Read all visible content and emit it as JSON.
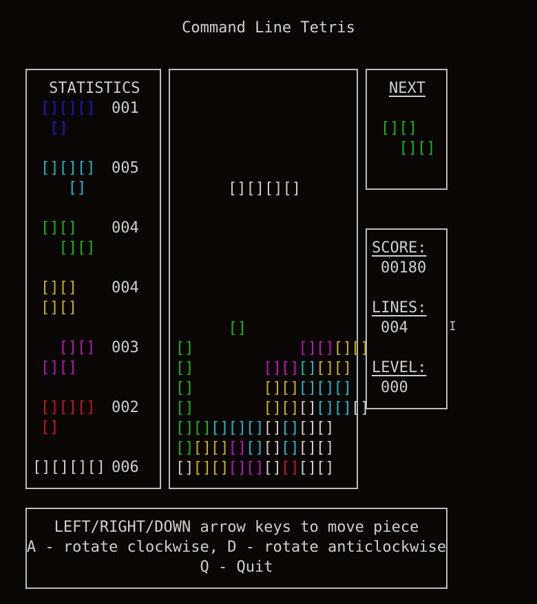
{
  "title": "Command Line Tetris",
  "colors": {
    "I": "#1a1ac8",
    "T": "#20b8c8",
    "Z": "#18b818",
    "O": "#c8b418",
    "S": "#b818b8",
    "L": "#c81818",
    "J": "#cfcfcf"
  },
  "block": "[]",
  "statistics": {
    "heading": "STATISTICS",
    "pieces": [
      {
        "kind": "I",
        "rows": [
          "[][][]",
          " []"
        ],
        "count": "001"
      },
      {
        "kind": "T",
        "rows": [
          "[][][]",
          "   []"
        ],
        "count": "005"
      },
      {
        "kind": "Z",
        "rows": [
          "[][]",
          "  [][]"
        ],
        "count": "004"
      },
      {
        "kind": "O",
        "rows": [
          "[][]",
          "[][]"
        ],
        "count": "004"
      },
      {
        "kind": "S",
        "rows": [
          "  [][]",
          "[][]"
        ],
        "count": "003"
      },
      {
        "kind": "L",
        "rows": [
          "[][][]",
          "[]"
        ],
        "count": "002"
      },
      {
        "kind": "J",
        "rows": [
          "[][][][]"
        ],
        "count": "006"
      }
    ]
  },
  "board": {
    "current_piece": {
      "kind": "J",
      "text": "[][][][]"
    },
    "rows": [
      "   Z            ",
      "Z      SSOO     ",
      "Z    SSTOO      ",
      "Z    OOTTT      ",
      "Z    OOJTTJ     ",
      "ZZTTTJTJJ       ",
      "ZOOSTJTJJ       ",
      "JOOSSJLJJ       "
    ]
  },
  "next": {
    "heading": "NEXT",
    "kind": "Z",
    "rows": [
      "[][]",
      "  [][]"
    ]
  },
  "score": {
    "score_label": "SCORE:",
    "score_value": "00180",
    "lines_label": "LINES:",
    "lines_value": "004",
    "level_label": "LEVEL:",
    "level_value": "000"
  },
  "help": {
    "line1": "LEFT/RIGHT/DOWN arrow keys to move piece",
    "line2": "A - rotate clockwise, D - rotate anticlockwise",
    "line3": "Q - Quit"
  },
  "cursor_icon": "text-cursor-icon"
}
